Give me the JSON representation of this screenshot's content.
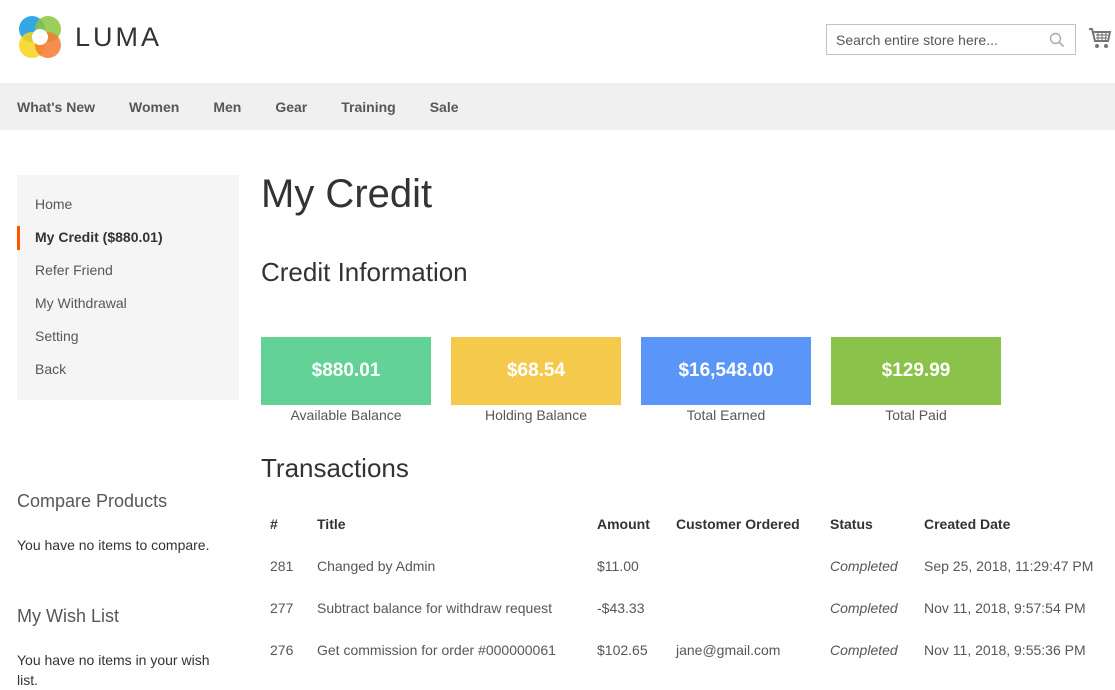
{
  "header": {
    "brand": "LUMA",
    "search_placeholder": "Search entire store here...",
    "search_value": ""
  },
  "nav": {
    "items": [
      {
        "label": "What's New"
      },
      {
        "label": "Women"
      },
      {
        "label": "Men"
      },
      {
        "label": "Gear"
      },
      {
        "label": "Training"
      },
      {
        "label": "Sale"
      }
    ]
  },
  "sidebar": {
    "items": [
      {
        "label": "Home",
        "active": false
      },
      {
        "label": "My Credit ($880.01)",
        "active": true
      },
      {
        "label": "Refer Friend",
        "active": false
      },
      {
        "label": "My Withdrawal",
        "active": false
      },
      {
        "label": "Setting",
        "active": false
      },
      {
        "label": "Back",
        "active": false
      }
    ],
    "active_accent": "#ff5501",
    "compare": {
      "title": "Compare Products",
      "text": "You have no items to compare."
    },
    "wishlist": {
      "title": "My Wish List",
      "text": "You have no items in your wish list."
    }
  },
  "main": {
    "page_title": "My Credit",
    "credit_info_title": "Credit Information",
    "cards": [
      {
        "value": "$880.01",
        "label": "Available Balance",
        "color": "#62d296"
      },
      {
        "value": "$68.54",
        "label": "Holding Balance",
        "color": "#f5c94c"
      },
      {
        "value": "$16,548.00",
        "label": "Total Earned",
        "color": "#5a96f8"
      },
      {
        "value": "$129.99",
        "label": "Total Paid",
        "color": "#8bc34a"
      }
    ],
    "transactions_title": "Transactions",
    "transactions": {
      "headers": [
        "#",
        "Title",
        "Amount",
        "Customer Ordered",
        "Status",
        "Created Date"
      ],
      "rows": [
        {
          "id": "281",
          "title": "Changed by Admin",
          "amount": "$11.00",
          "customer": "",
          "status": "Completed",
          "date": "Sep 25, 2018, 11:29:47 PM"
        },
        {
          "id": "277",
          "title": "Subtract balance for withdraw request",
          "amount": "-$43.33",
          "customer": "",
          "status": "Completed",
          "date": "Nov 11, 2018, 9:57:54 PM"
        },
        {
          "id": "276",
          "title": "Get commission for order #000000061",
          "amount": "$102.65",
          "customer": "jane@gmail.com",
          "status": "Completed",
          "date": "Nov 11, 2018, 9:55:36 PM"
        }
      ]
    }
  }
}
